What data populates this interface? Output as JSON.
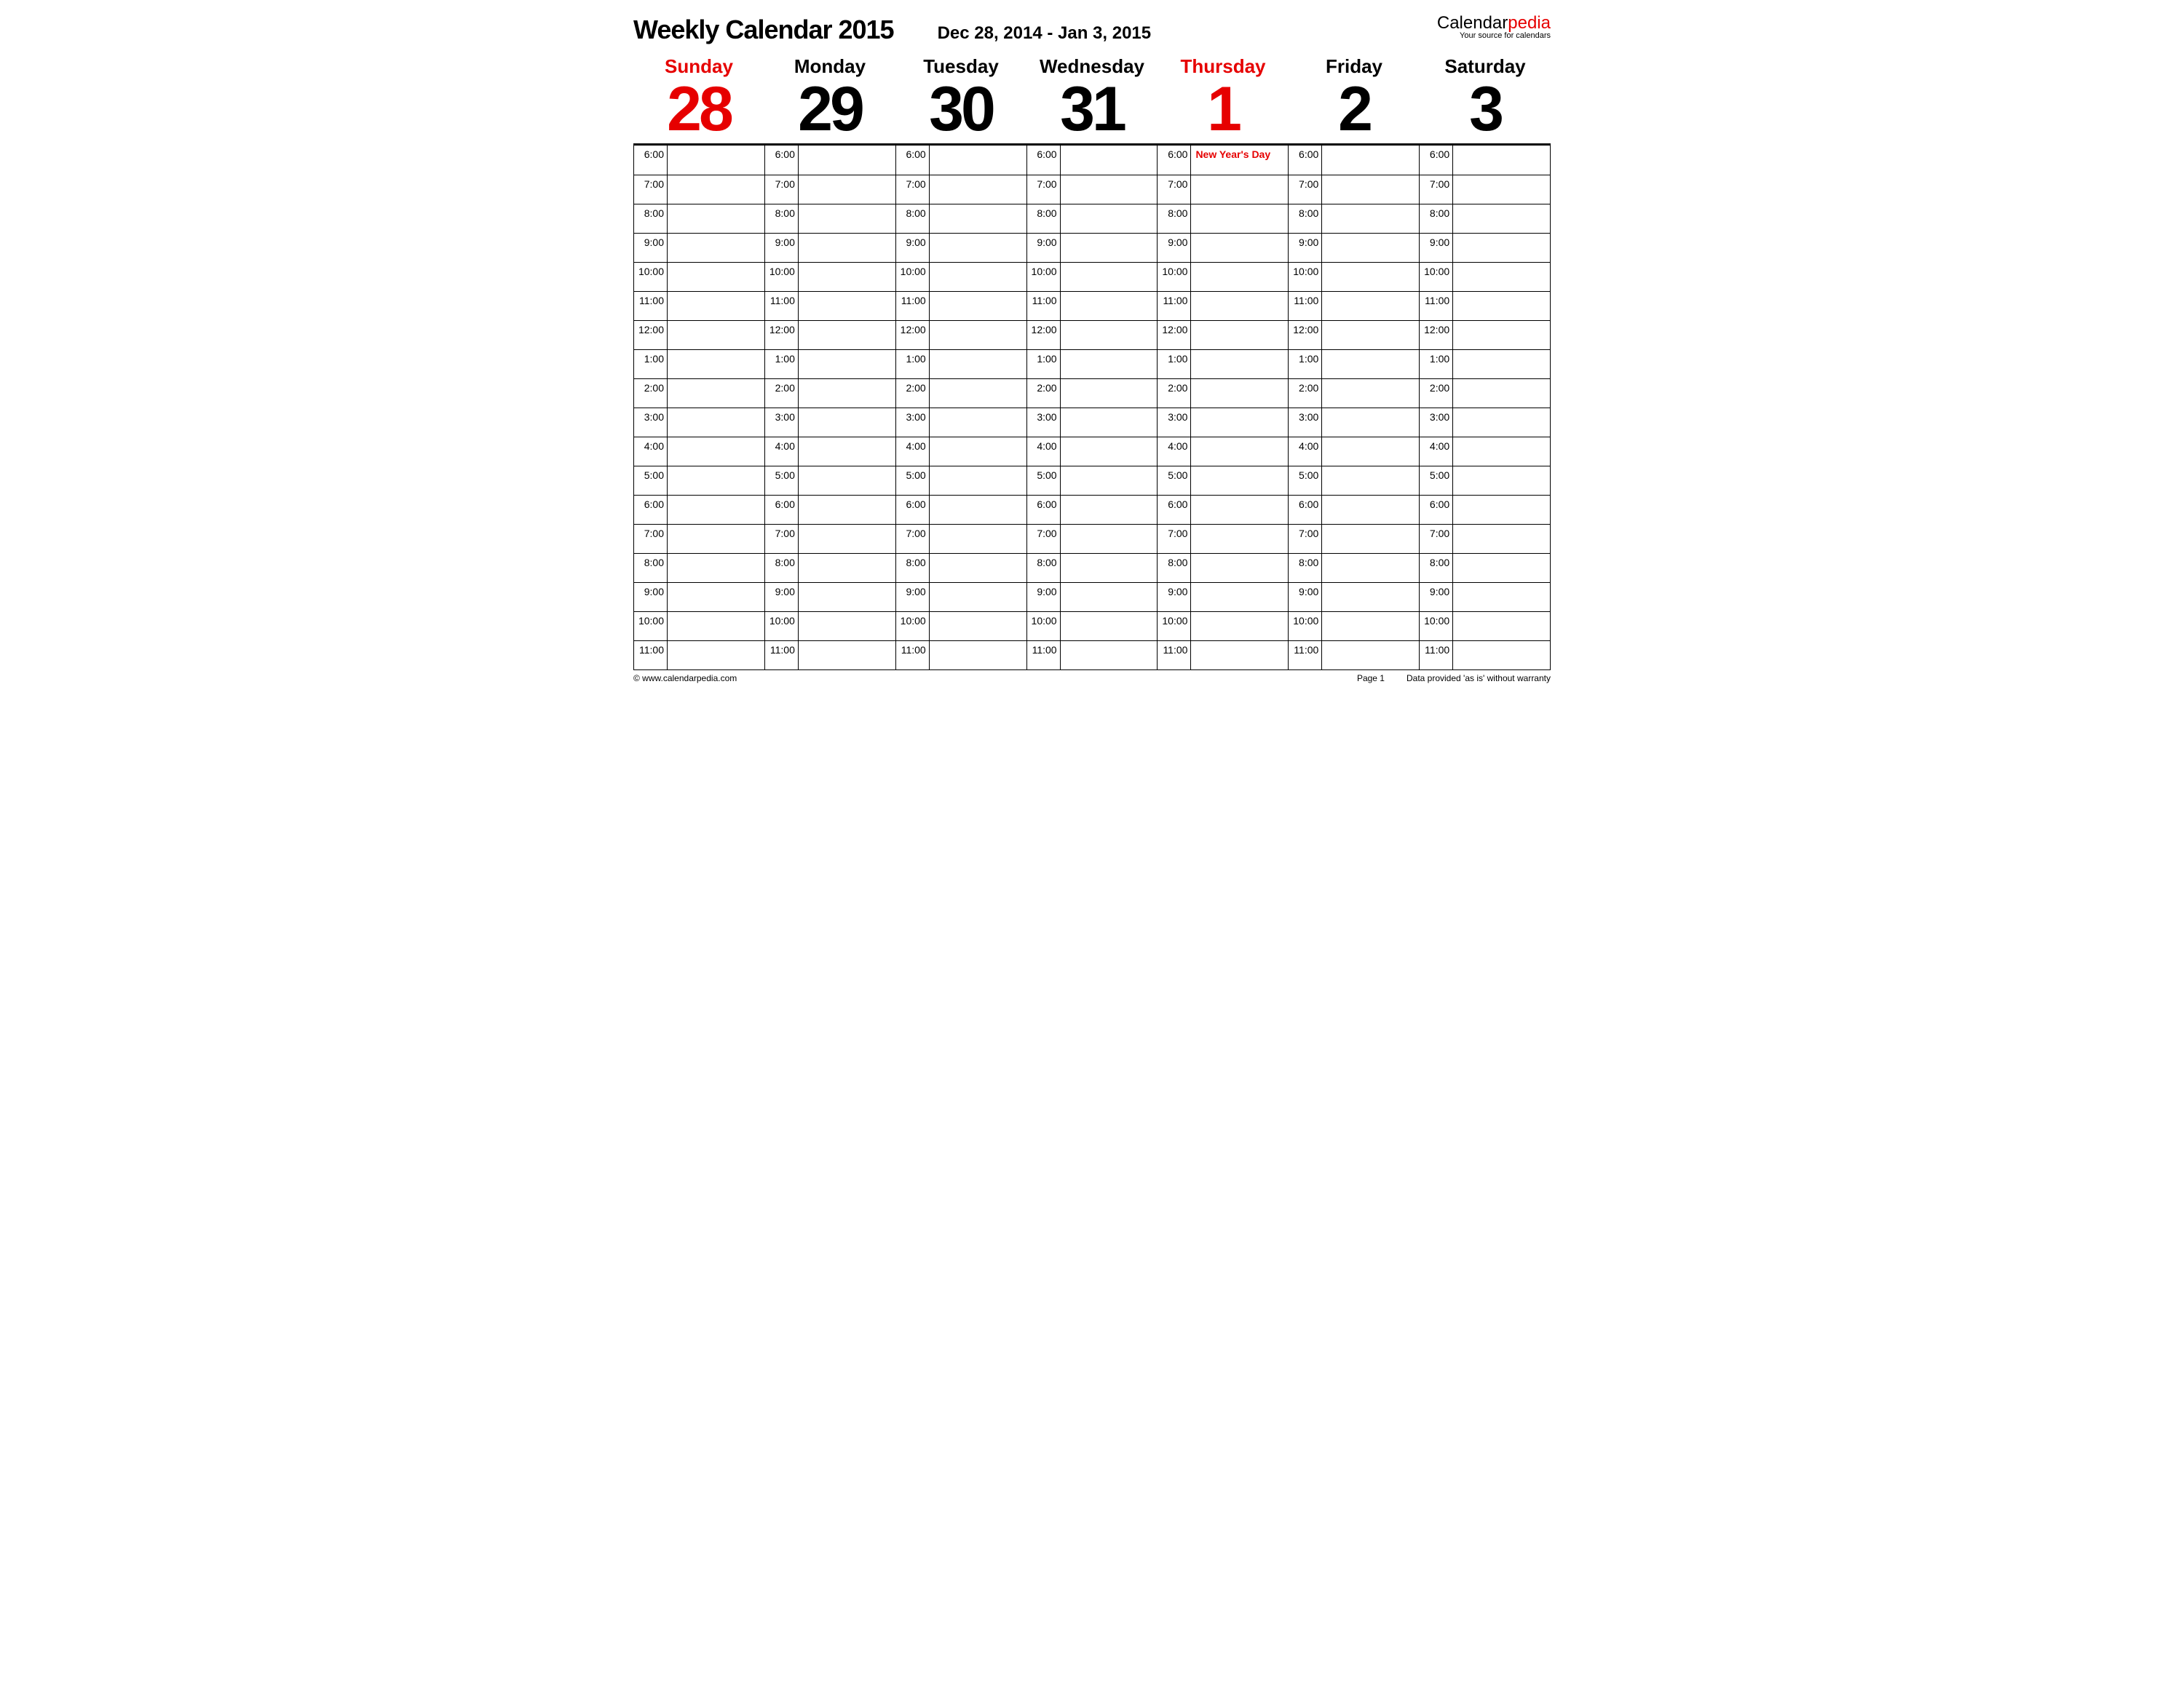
{
  "header": {
    "title": "Weekly Calendar 2015",
    "date_range": "Dec 28, 2014 - Jan 3, 2015",
    "brand_prefix": "Calendar",
    "brand_suffix": "pedia",
    "brand_tagline": "Your source for calendars"
  },
  "days": [
    {
      "name": "Sunday",
      "num": "28",
      "highlight": true
    },
    {
      "name": "Monday",
      "num": "29",
      "highlight": false
    },
    {
      "name": "Tuesday",
      "num": "30",
      "highlight": false
    },
    {
      "name": "Wednesday",
      "num": "31",
      "highlight": false
    },
    {
      "name": "Thursday",
      "num": "1",
      "highlight": true
    },
    {
      "name": "Friday",
      "num": "2",
      "highlight": false
    },
    {
      "name": "Saturday",
      "num": "3",
      "highlight": false
    }
  ],
  "times": [
    "6:00",
    "7:00",
    "8:00",
    "9:00",
    "10:00",
    "11:00",
    "12:00",
    "1:00",
    "2:00",
    "3:00",
    "4:00",
    "5:00",
    "6:00",
    "7:00",
    "8:00",
    "9:00",
    "10:00",
    "11:00"
  ],
  "events": {
    "4": {
      "0": "New Year's Day"
    }
  },
  "footer": {
    "copyright": "© www.calendarpedia.com",
    "page": "Page 1",
    "disclaimer": "Data provided 'as is' without warranty"
  }
}
